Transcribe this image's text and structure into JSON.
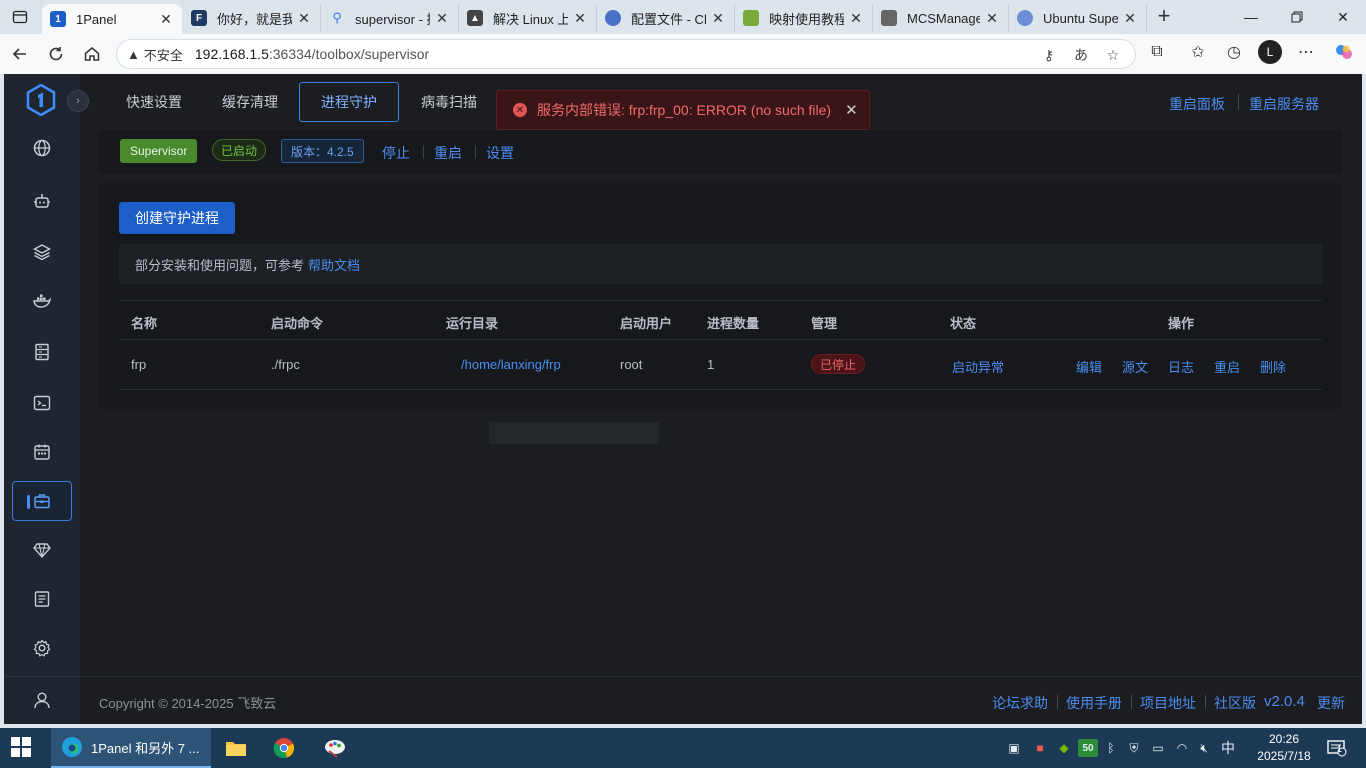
{
  "browser": {
    "tabs": [
      {
        "title": "1Panel",
        "active": true,
        "favicon_color": "#1b5fc7"
      },
      {
        "title": "你好，就是我问",
        "active": false,
        "favicon_color": "#1f3b63"
      },
      {
        "title": "supervisor - 搜",
        "active": false,
        "favicon_color": "#3a7be0"
      },
      {
        "title": "解决 Linux 上的",
        "active": false,
        "favicon_color": "#444444"
      },
      {
        "title": "配置文件 - Chr",
        "active": false,
        "favicon_color": "#4a70c8"
      },
      {
        "title": "映射使用教程",
        "active": false,
        "favicon_color": "#79a93b"
      },
      {
        "title": "MCSManager",
        "active": false,
        "favicon_color": "#666666"
      },
      {
        "title": "Ubuntu Super",
        "active": false,
        "favicon_color": "#6b8fd6"
      }
    ],
    "address": {
      "security_label": "不安全",
      "host": "192.168.1.5",
      "path": ":36334/toolbox/supervisor"
    }
  },
  "sidebar": {
    "items": [
      {
        "icon": "globe-icon"
      },
      {
        "icon": "robot-icon"
      },
      {
        "icon": "layers-icon"
      },
      {
        "icon": "docker-icon"
      },
      {
        "icon": "database-icon"
      },
      {
        "icon": "terminal-icon"
      },
      {
        "icon": "calendar-icon"
      },
      {
        "icon": "toolbox-icon",
        "active": true
      },
      {
        "icon": "diamond-icon"
      },
      {
        "icon": "log-icon"
      },
      {
        "icon": "settings-icon"
      }
    ]
  },
  "topnav": {
    "tabs": [
      "快速设置",
      "缓存清理",
      "进程守护",
      "病毒扫描"
    ],
    "active_tab": "进程守护",
    "restart_panel": "重启面板",
    "restart_server": "重启服务器"
  },
  "toast": {
    "message": "服务内部错误: frp:frp_00: ERROR (no such file)"
  },
  "status": {
    "service_name": "Supervisor",
    "state": "已启动",
    "version": "版本：4.2.5",
    "stop": "停止",
    "restart": "重启",
    "settings": "设置"
  },
  "panel": {
    "create_button": "创建守护进程",
    "notice_text": "部分安装和使用问题，可参考",
    "notice_link": "帮助文档"
  },
  "table": {
    "headers": [
      "名称",
      "启动命令",
      "运行目录",
      "启动用户",
      "进程数量",
      "管理",
      "状态",
      "操作"
    ],
    "rows": [
      {
        "name": "frp",
        "command": "./frpc",
        "directory": "/home/lanxing/frp",
        "user": "root",
        "count": "1",
        "manage": "已停止",
        "status": "启动异常",
        "actions": [
          "编辑",
          "源文",
          "日志",
          "重启",
          "删除"
        ]
      }
    ]
  },
  "footer": {
    "copyright": "Copyright © 2014-2025 飞致云",
    "links": [
      "论坛求助",
      "使用手册",
      "项目地址",
      "社区版"
    ],
    "version": "v2.0.4",
    "update": "更新"
  },
  "taskbar": {
    "active_app": "1Panel 和另外 7 ...",
    "time": "20:26",
    "date": "2025/7/18",
    "ime": "中",
    "notifications": "1"
  }
}
